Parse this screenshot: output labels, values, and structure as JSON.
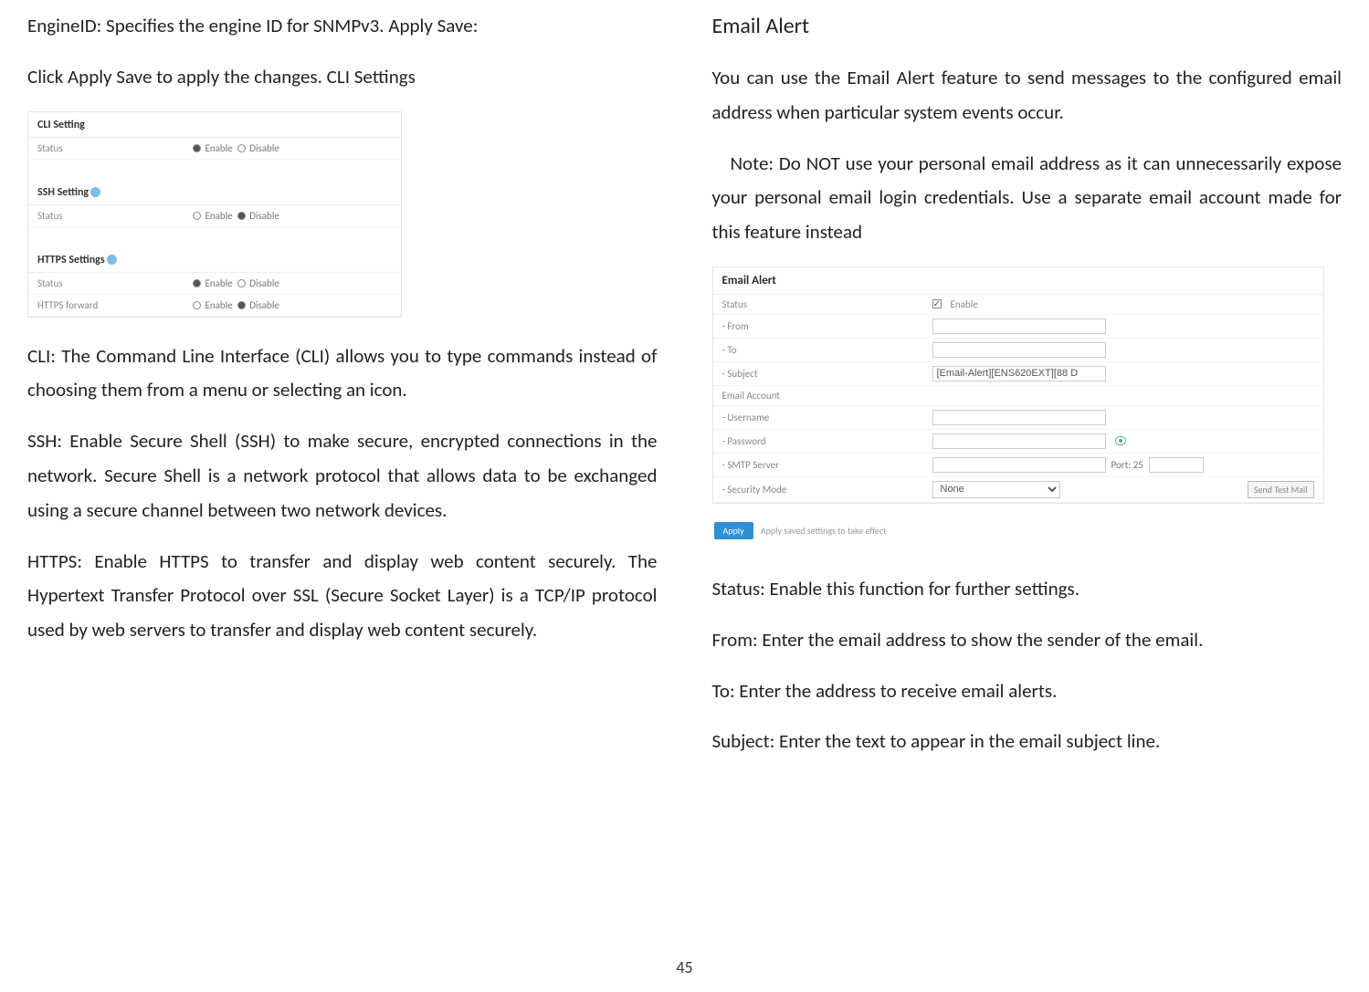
{
  "left": {
    "p1": "EngineID: Specifies the engine ID for SNMPv3. Apply Save:",
    "p2": "Click Apply Save to apply the changes. CLI Settings",
    "cli_panel": {
      "s1_title": "CLI Setting",
      "s1_row_label": "Status",
      "s1_opt1": "Enable",
      "s1_opt2": "Disable",
      "s2_title": "SSH Setting",
      "s2_row_label": "Status",
      "s2_opt1": "Enable",
      "s2_opt2": "Disable",
      "s3_title": "HTTPS Settings",
      "s3_row1_label": "Status",
      "s3_row1_opt1": "Enable",
      "s3_row1_opt2": "Disable",
      "s3_row2_label": "HTTPS forward",
      "s3_row2_opt1": "Enable",
      "s3_row2_opt2": "Disable"
    },
    "p3": "CLI: The Command Line Interface (CLI) allows you to type commands instead of choosing them from a menu or selecting an icon.",
    "p4": "SSH: Enable Secure Shell (SSH) to make secure, encrypted connections in the network. Secure Shell is a network protocol that allows data to be exchanged using a secure channel between two network devices.",
    "p5": "HTTPS: Enable HTTPS to transfer and display web content securely. The Hypertext Transfer Protocol over SSL (Secure Socket Layer) is a TCP/IP protocol used by web servers to transfer and display web content securely."
  },
  "right": {
    "h": "Email Alert",
    "p1": "You can use the Email Alert feature to send messages to the configured email address when particular system events occur.",
    "p2": "Note: Do NOT use your personal email address as it can unnecessarily expose your personal email login credentials. Use a separate email account made for this feature instead",
    "email_panel": {
      "title": "Email Alert",
      "status_label": "Status",
      "status_opt": "Enable",
      "from_label": "- From",
      "to_label": "- To",
      "subject_label": "- Subject",
      "subject_value": "[Email-Alert][ENS620EXT][88 D",
      "account_label": "Email Account",
      "username_label": "- Username",
      "password_label": "- Password",
      "smtp_label": "- SMTP Server",
      "port_text": "Port: 25",
      "security_label": "- Security Mode",
      "security_value": "None",
      "test_btn": "Send Test Mail",
      "apply_btn": "Apply",
      "apply_note": "Apply saved settings to take effect"
    },
    "p3": "Status: Enable this function for further settings.",
    "p4": "From: Enter the email address to show the sender of the email.",
    "p5": "To: Enter the address to receive email alerts.",
    "p6": "Subject: Enter the text to appear in the email subject line."
  },
  "page_number": "45"
}
